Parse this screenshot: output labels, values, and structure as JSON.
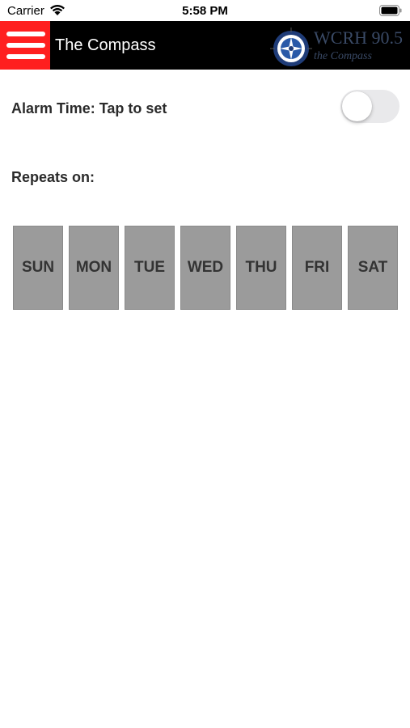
{
  "status_bar": {
    "carrier": "Carrier",
    "time": "5:58 PM",
    "wifi_icon": "wifi-icon",
    "battery_icon": "battery-icon"
  },
  "nav": {
    "title": "The Compass",
    "menu_icon": "hamburger-menu-icon",
    "menu_color": "#ff1f1f",
    "logo_text": "WCRH 90.5",
    "logo_subtext": "the Compass"
  },
  "alarm": {
    "label": "Alarm Time: Tap to set",
    "enabled": false
  },
  "repeats": {
    "label": "Repeats on:",
    "days": [
      {
        "label": "SUN"
      },
      {
        "label": "MON"
      },
      {
        "label": "TUE"
      },
      {
        "label": "WED"
      },
      {
        "label": "THU"
      },
      {
        "label": "FRI"
      },
      {
        "label": "SAT"
      }
    ]
  }
}
